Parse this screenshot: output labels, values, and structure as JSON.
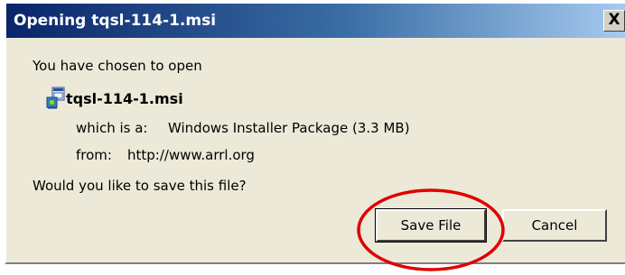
{
  "window": {
    "title": "Opening tqsl-114-1.msi",
    "close_glyph": "X"
  },
  "body": {
    "intro": "You have chosen to open",
    "file_name": "tqsl-114-1.msi",
    "file_icon": "msi-installer-icon",
    "type_label": "which is a:",
    "type_value": "Windows Installer Package (3.3 MB)",
    "from_label": "from:",
    "from_value": "http://www.arrl.org",
    "question": "Would you like to save this file?"
  },
  "buttons": {
    "save": "Save File",
    "cancel": "Cancel"
  },
  "colors": {
    "annotation": "#e00000",
    "titlebar": "#0a246a",
    "dialog_bg": "#ece9d8"
  }
}
